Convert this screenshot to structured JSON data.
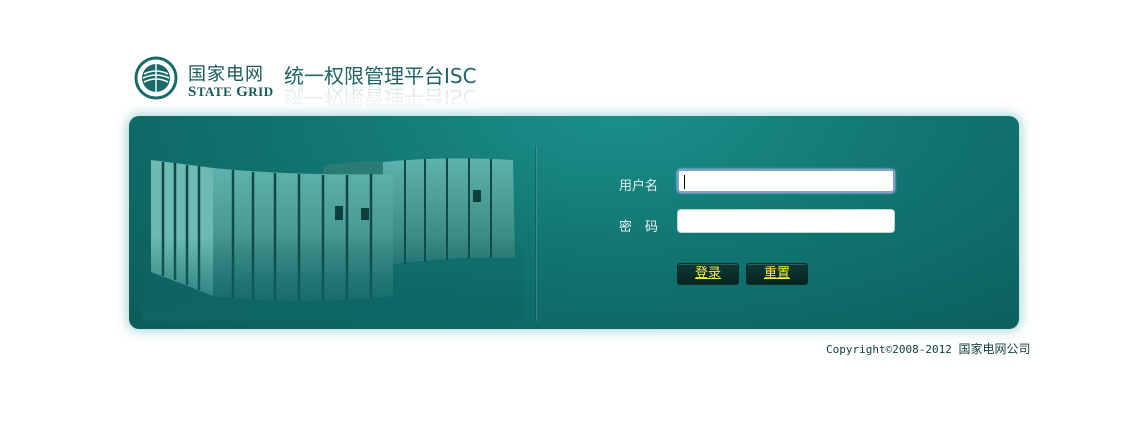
{
  "header": {
    "brand_cn": "国家电网",
    "brand_en_first_S": "S",
    "brand_en_rest_1": "TATE ",
    "brand_en_first_G": "G",
    "brand_en_rest_2": "RID",
    "system_title": "统一权限管理平台ISC",
    "emblem_icon": "state-grid-emblem-icon"
  },
  "login": {
    "username_label": "用户名",
    "password_label": "密　码",
    "username_value": "",
    "password_value": "",
    "login_button": "登录",
    "reset_button": "重置"
  },
  "footer": {
    "copyright": "Copyright©2008-2012",
    "company": "国家电网公司"
  },
  "colors": {
    "panel": "#117572",
    "button_text": "#f6ec42",
    "brand": "#16595a"
  }
}
